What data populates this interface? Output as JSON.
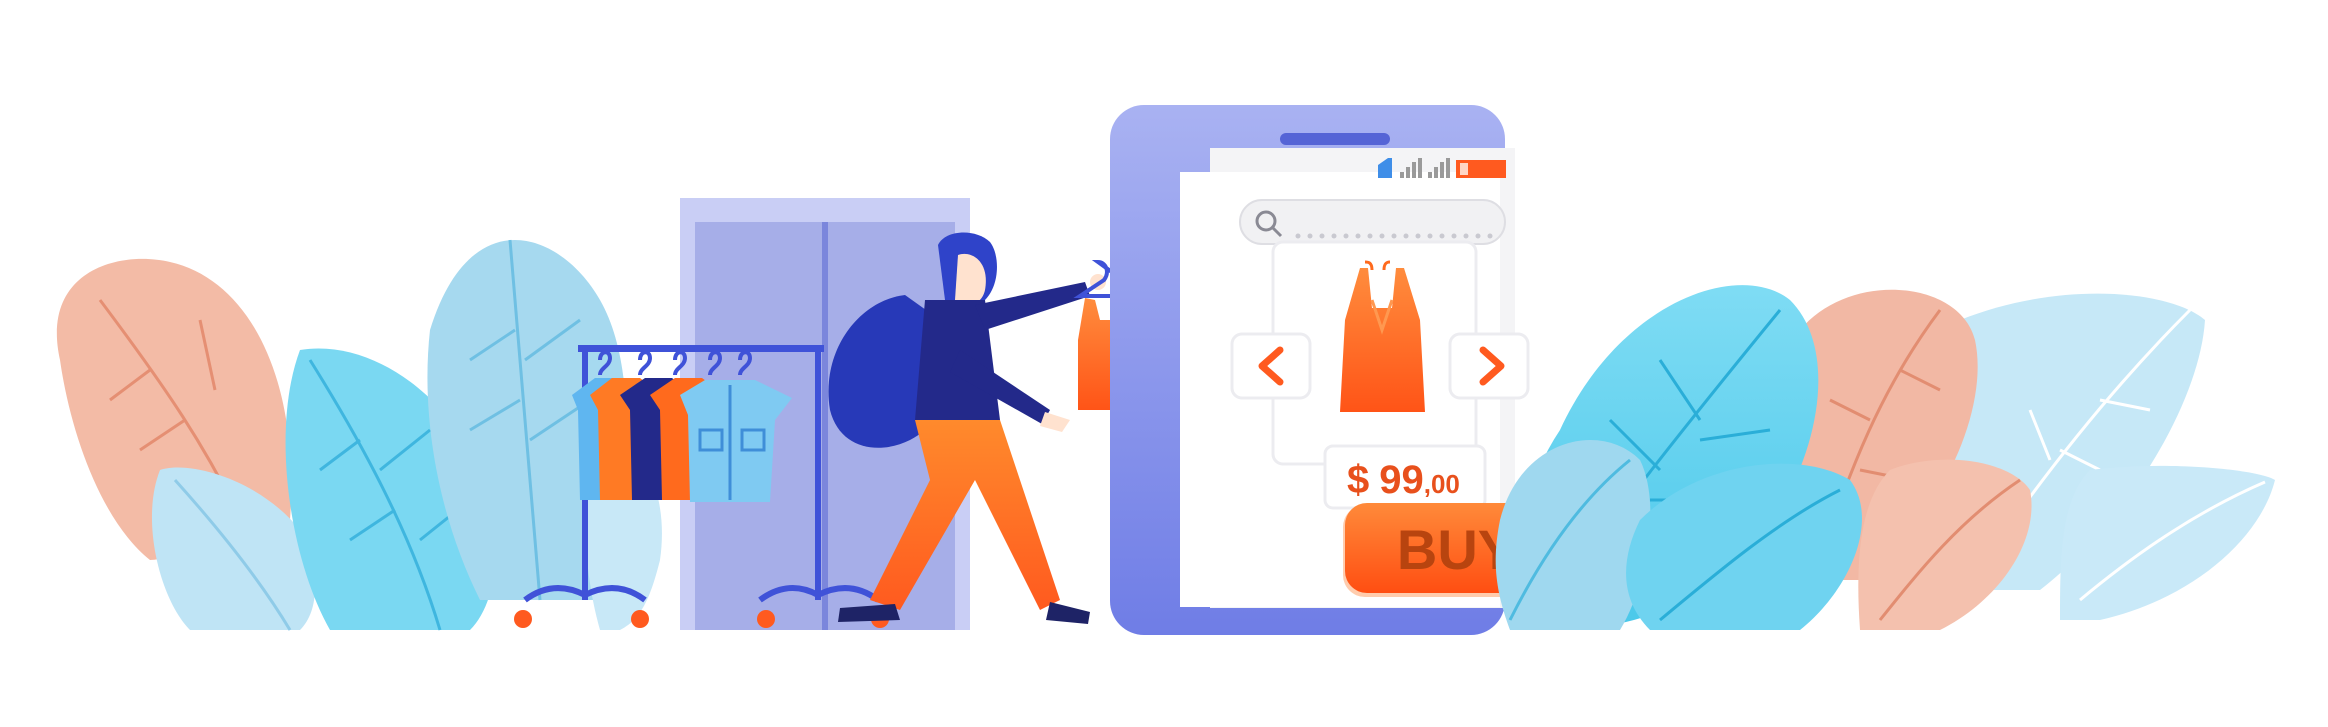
{
  "product": {
    "price_currency": "$",
    "price_main": "99",
    "price_cents": ",00",
    "buy_label": "BUY"
  },
  "colors": {
    "accent_orange": "#ff5a1f",
    "phone_blue": "#7b88e8",
    "leaf_peach": "#f2b6a3",
    "leaf_light_blue": "#a9dcf2",
    "leaf_cyan": "#5fd0ee",
    "navy": "#2a2f8c"
  },
  "icons": {
    "search": "search-icon",
    "prev": "chevron-left-icon",
    "next": "chevron-right-icon",
    "signal": "signal-icon",
    "battery": "battery-icon"
  }
}
